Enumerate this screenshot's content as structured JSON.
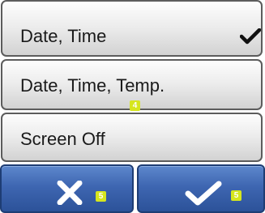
{
  "options": [
    {
      "label": "Date, Time",
      "selected": true,
      "check_icon": "check-icon"
    },
    {
      "label": "Date, Time, Temp.",
      "selected": false
    },
    {
      "label": "Screen Off",
      "selected": false
    }
  ],
  "list_badge": "4",
  "buttons": {
    "cancel": {
      "icon": "close-icon",
      "badge": "5"
    },
    "confirm": {
      "icon": "check-icon",
      "badge": "5"
    }
  },
  "colors": {
    "option_bg": "#ececec",
    "option_border": "#5c5c5c",
    "button_bg": "#3e66b1",
    "badge_bg": "#d6e61e"
  }
}
